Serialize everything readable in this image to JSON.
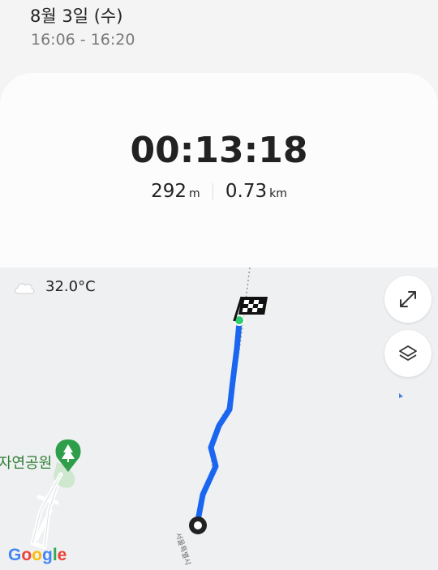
{
  "header": {
    "date": "8월 3일 (수)",
    "time_range": "16:06 - 16:20"
  },
  "summary": {
    "duration": "00:13:18",
    "steps": {
      "value": "292",
      "unit": "m"
    },
    "distance": {
      "value": "0.73",
      "unit": "km"
    }
  },
  "map": {
    "weather": {
      "icon": "cloud-icon",
      "temperature": "32.0°C"
    },
    "park_label": "자연공원",
    "street_label": "서울특별시",
    "attribution": "Google",
    "buttons": {
      "expand": "expand-icon",
      "layers": "layers-icon"
    },
    "colors": {
      "route": "#1a66f0",
      "start_marker": "#222222",
      "finish_dot": "#2ecc71",
      "park": "#2e7d32"
    }
  }
}
